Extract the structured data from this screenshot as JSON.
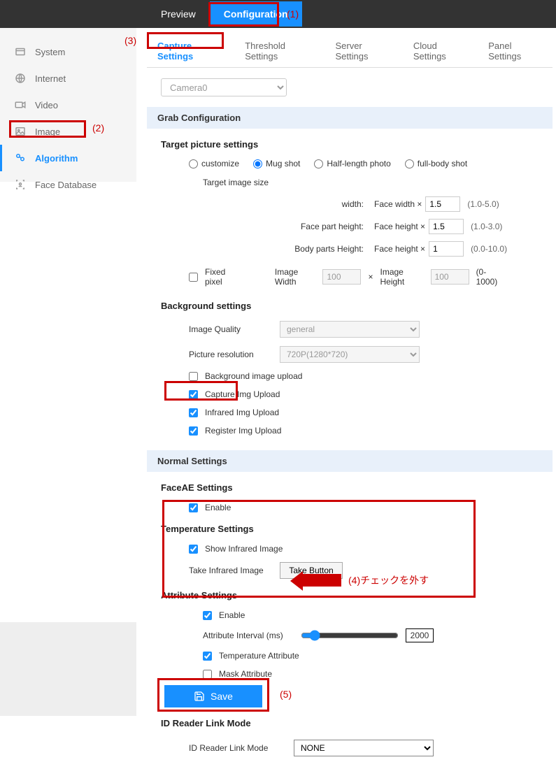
{
  "top_nav": {
    "preview": "Preview",
    "configuration": "Configuration"
  },
  "sidebar": {
    "system": "System",
    "internet": "Internet",
    "video": "Video",
    "image": "Image",
    "algorithm": "Algorithm",
    "face_database": "Face Database"
  },
  "sub_tabs": {
    "capture": "Capture Settings",
    "threshold": "Threshold Settings",
    "server": "Server Settings",
    "cloud": "Cloud Settings",
    "panel": "Panel Settings"
  },
  "camera_select": "Camera0",
  "grab": {
    "header": "Grab Configuration",
    "target_title": "Target picture settings",
    "target_image_size": "Target image size",
    "radios": {
      "customize": "customize",
      "mugshot": "Mug shot",
      "halflength": "Half-length photo",
      "fullbody": "full-body shot"
    },
    "width_label": "width:",
    "width_prefix": "Face width  ×",
    "width_val": "1.5",
    "width_hint": "(1.0-5.0)",
    "facepart_label": "Face part height:",
    "facepart_prefix": "Face height  ×",
    "facepart_val": "1.5",
    "facepart_hint": "(1.0-3.0)",
    "bodypart_label": "Body parts Height:",
    "bodypart_prefix": "Face height  ×",
    "bodypart_val": "1",
    "bodypart_hint": "(0.0-10.0)",
    "fixed_pixel": "Fixed pixel",
    "image_width": "Image Width",
    "image_width_val": "100",
    "mult": "×",
    "image_height": "Image Height",
    "image_height_val": "100",
    "image_hint": "(0-1000)"
  },
  "background": {
    "title": "Background settings",
    "quality_label": "Image Quality",
    "quality_val": "general",
    "resolution_label": "Picture resolution",
    "resolution_val": "720P(1280*720)",
    "bg_upload": "Background image upload",
    "capture_upload": "Capture Img Upload",
    "infrared_upload": "Infrared Img Upload",
    "register_upload": "Register Img Upload"
  },
  "normal": {
    "header": "Normal Settings",
    "faceae_title": "FaceAE Settings",
    "enable": "Enable",
    "temp_title": "Temperature Settings",
    "show_infrared": "Show Infrared Image",
    "take_infrared": "Take Infrared Image",
    "take_button": "Take Button",
    "attr_title": "Attribute Settings",
    "attr_enable": "Enable",
    "attr_interval": "Attribute Interval (ms)",
    "attr_interval_val": "2000",
    "temp_attr": "Temperature Attribute",
    "mask_attr": "Mask Attribute"
  },
  "id_reader": {
    "title": "ID Reader Link Mode",
    "label": "ID Reader Link Mode",
    "value": "NONE"
  },
  "save": "Save",
  "annotations": {
    "a1": "(1)",
    "a2": "(2)",
    "a3": "(3)",
    "a4": "(4)チェックを外す",
    "a5": "(5)"
  }
}
